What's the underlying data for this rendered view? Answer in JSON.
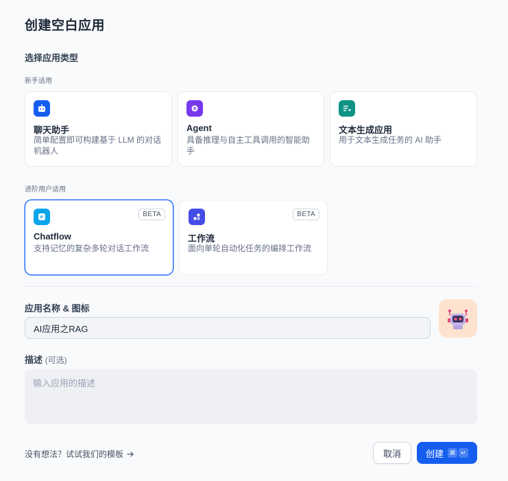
{
  "dialog": {
    "title": "创建空白应用",
    "select_type_label": "选择应用类型"
  },
  "beginner": {
    "label": "新手适用",
    "cards": [
      {
        "name": "聊天助手",
        "desc": "简单配置即可构建基于 LLM 的对话机器人",
        "icon": "chat-bot-icon",
        "color": "#155eef"
      },
      {
        "name": "Agent",
        "desc": "具备推理与自主工具调用的智能助手",
        "icon": "agent-icon",
        "color": "#7839ee"
      },
      {
        "name": "文本生成应用",
        "desc": "用于文本生成任务的 AI 助手",
        "icon": "text-generation-icon",
        "color": "#0e9384"
      }
    ]
  },
  "advanced": {
    "label": "进阶用户适用",
    "cards": [
      {
        "name": "Chatflow",
        "desc": "支持记忆的复杂多轮对话工作流",
        "badge": "BETA",
        "icon": "chatflow-icon",
        "color": "#0ba5ec",
        "selected": true
      },
      {
        "name": "工作流",
        "desc": "面向单轮自动化任务的编排工作流",
        "badge": "BETA",
        "icon": "workflow-icon",
        "color": "#444ce7",
        "selected": false
      }
    ]
  },
  "form": {
    "name_label": "应用名称 & 图标",
    "name_value": "AI应用之RAG",
    "avatar_icon": "robot-icon",
    "desc_label": "描述",
    "desc_optional": "(可选)",
    "desc_placeholder": "输入应用的描述"
  },
  "footer": {
    "template_link": "没有想法？试试我们的模板",
    "cancel_label": "取消",
    "create_label": "创建",
    "shortcut_keys": [
      "⌘",
      "↵"
    ]
  }
}
